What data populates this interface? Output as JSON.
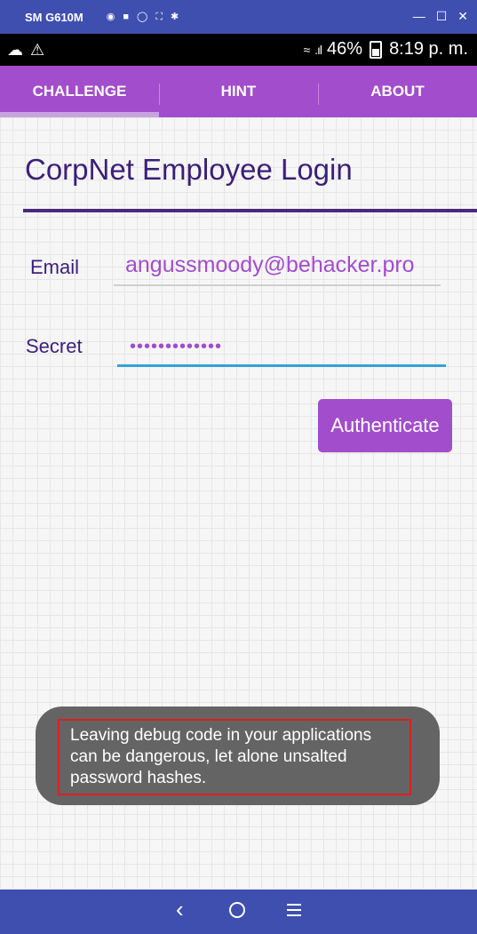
{
  "window": {
    "title": "SM G610M"
  },
  "statusbar": {
    "battery": "46%",
    "time": "8:19 p. m."
  },
  "tabs": [
    {
      "label": "CHALLENGE",
      "active": true
    },
    {
      "label": "HINT",
      "active": false
    },
    {
      "label": "ABOUT",
      "active": false
    }
  ],
  "login": {
    "title": "CorpNet Employee Login",
    "email_label": "Email",
    "email_value": "angussmoody@behacker.pro",
    "secret_label": "Secret",
    "secret_value": "•••••••••••••",
    "button_label": "Authenticate"
  },
  "toast": {
    "message": "Leaving debug code in your applications can be dangerous, let alone unsalted password hashes."
  },
  "colors": {
    "accent": "#a24dcc",
    "title": "#3b1f78",
    "window_bar": "#3f4fb0",
    "toast_border": "#e01e1e"
  },
  "icons": {
    "window_tools": [
      "camera-icon",
      "video-icon",
      "headset-icon",
      "fullscreen-icon",
      "settings-icon"
    ],
    "statusbar_left": [
      "cloud-icon",
      "warning-icon"
    ],
    "nav": [
      "back-icon",
      "home-icon",
      "menu-icon"
    ]
  }
}
